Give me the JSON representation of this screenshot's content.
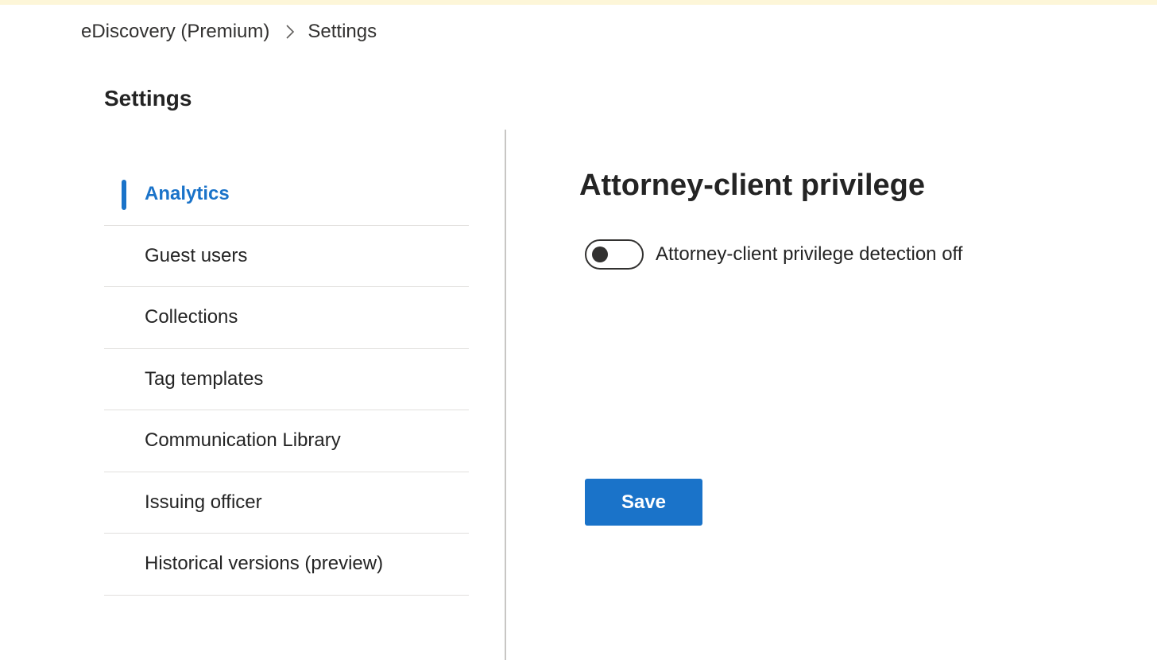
{
  "theme": {
    "accent": "#1a73c9",
    "banner": "#fdf6d8"
  },
  "breadcrumb": {
    "items": [
      {
        "label": "eDiscovery (Premium)"
      },
      {
        "label": "Settings"
      }
    ],
    "separator_icon": "chevron-right-icon"
  },
  "page": {
    "title": "Settings"
  },
  "nav": {
    "items": [
      {
        "label": "Analytics",
        "active": true
      },
      {
        "label": "Guest users"
      },
      {
        "label": "Collections"
      },
      {
        "label": "Tag templates"
      },
      {
        "label": "Communication Library"
      },
      {
        "label": "Issuing officer"
      },
      {
        "label": "Historical versions (preview)"
      }
    ]
  },
  "content": {
    "section_title": "Attorney-client privilege",
    "toggle": {
      "label": "Attorney-client privilege detection off",
      "checked": false
    },
    "save_label": "Save"
  }
}
